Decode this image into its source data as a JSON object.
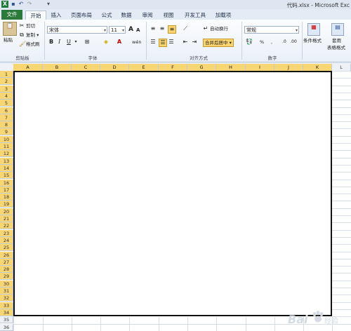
{
  "window": {
    "title": "代码.xlsx - Microsoft Exc",
    "quick_access": [
      "excel-logo-icon",
      "save-icon",
      "undo-icon",
      "redo-icon",
      "customize-icon"
    ]
  },
  "tabs": [
    {
      "label": "文件",
      "kind": "file"
    },
    {
      "label": "开始",
      "kind": "active"
    },
    {
      "label": "插入",
      "kind": ""
    },
    {
      "label": "页面布局",
      "kind": ""
    },
    {
      "label": "公式",
      "kind": ""
    },
    {
      "label": "数据",
      "kind": ""
    },
    {
      "label": "审阅",
      "kind": ""
    },
    {
      "label": "视图",
      "kind": ""
    },
    {
      "label": "开发工具",
      "kind": ""
    },
    {
      "label": "加载项",
      "kind": ""
    }
  ],
  "ribbon": {
    "clipboard": {
      "paste": "粘贴",
      "cut": "剪切",
      "copy": "复制 ▾",
      "format_painter": "格式刷",
      "label": "剪贴板"
    },
    "font": {
      "name": "宋体",
      "size": "11",
      "bold": "B",
      "italic": "I",
      "underline": "U",
      "grow": "A",
      "shrink": "A",
      "phonetic": "wén",
      "label": "字体"
    },
    "alignment": {
      "wrap": "自动换行",
      "merge": "合并后居中 ▾",
      "label": "对齐方式"
    },
    "number": {
      "format": "常规",
      "percent": "%",
      "comma": ",",
      "label": "数字"
    },
    "styles": {
      "conditional": "条件格式",
      "table_format_line1": "套用",
      "table_format_line2": "表格格式"
    }
  },
  "sheet": {
    "columns": [
      "A",
      "B",
      "C",
      "D",
      "E",
      "F",
      "G",
      "H",
      "I",
      "J",
      "K",
      "L"
    ],
    "selected_columns": [
      "A",
      "B",
      "C",
      "D",
      "E",
      "F",
      "G",
      "H",
      "I",
      "J",
      "K"
    ],
    "rows_selected_through": 34,
    "rows_visible": 36
  },
  "watermark": {
    "text": "Bai",
    "suffix": "经验"
  },
  "colors": {
    "file_tab": "#2b7a3b",
    "selection_header": "#f8d673",
    "accent": "#2b579a"
  }
}
